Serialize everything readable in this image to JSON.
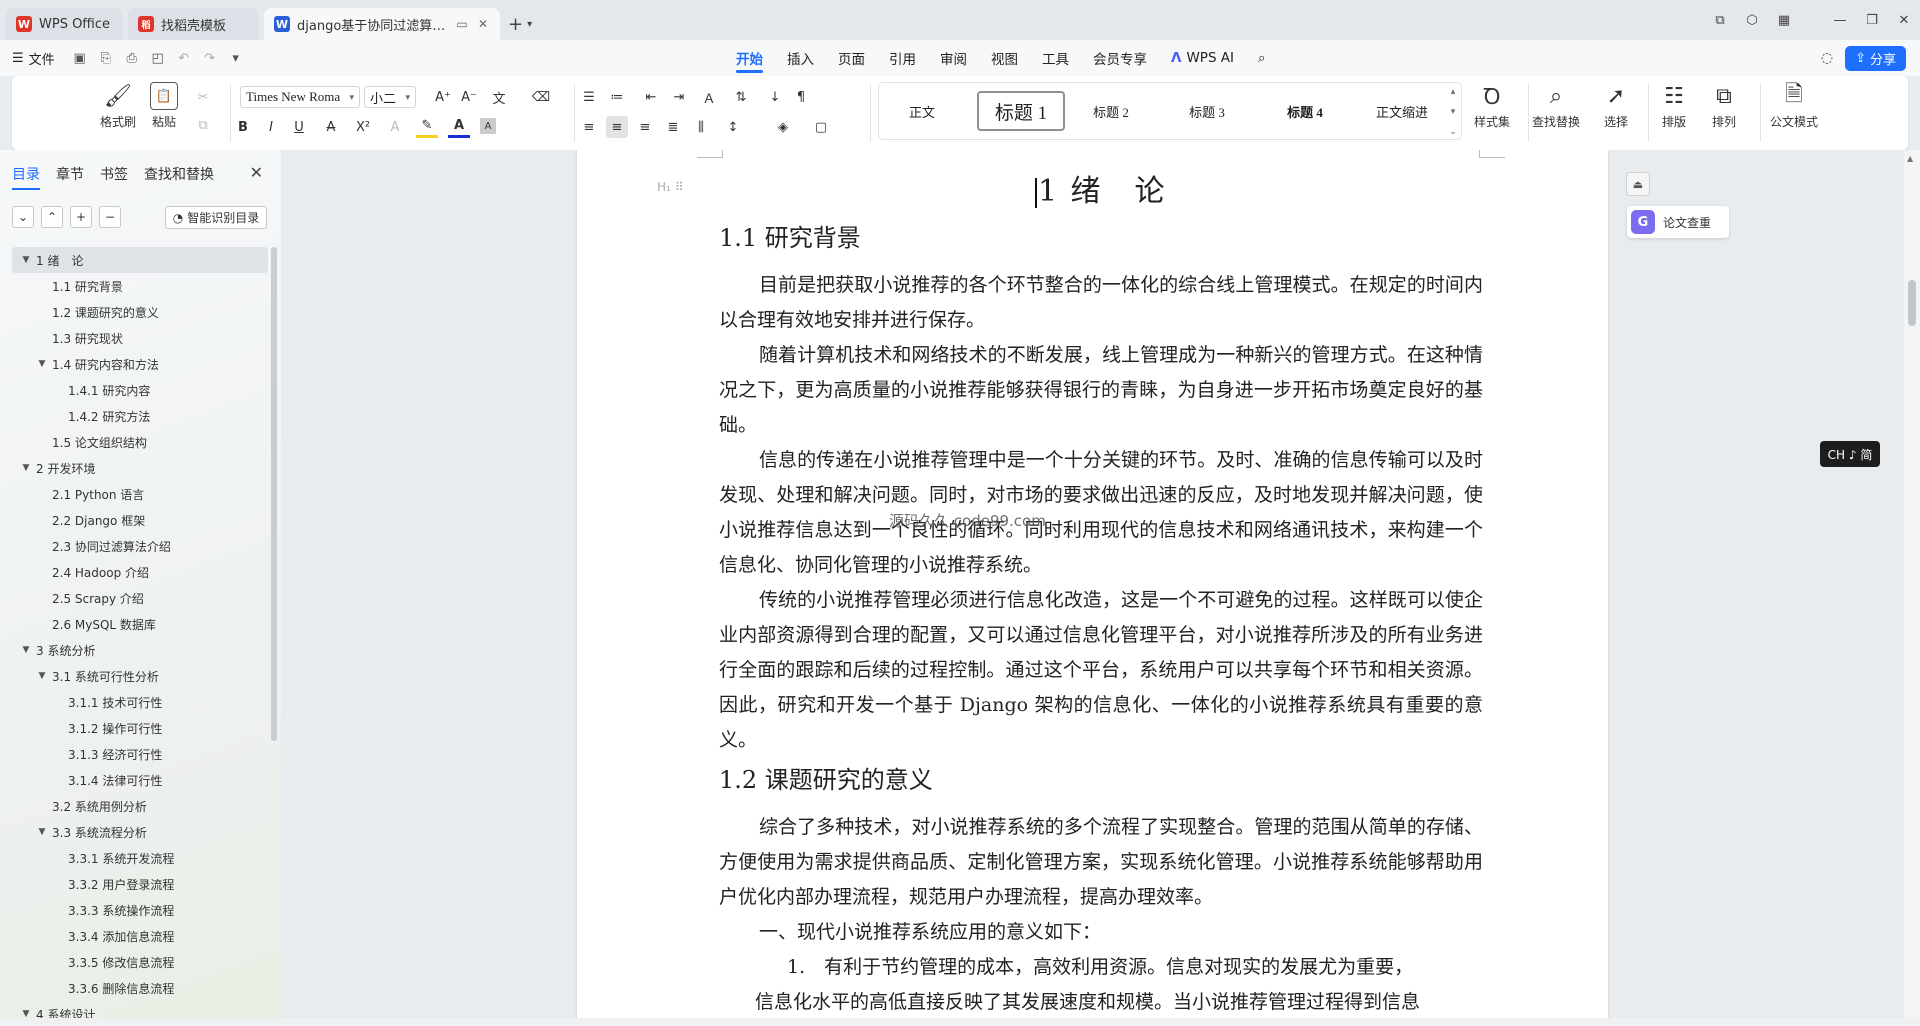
{
  "tabs": [
    {
      "label": "WPS Office",
      "logo": "W",
      "logo_color": "#e0352b",
      "active": false
    },
    {
      "label": "找稻壳模板",
      "logo": "稻",
      "logo_color": "#e0352b",
      "active": false
    },
    {
      "label": "django基于协同过滤算法的小",
      "logo": "W",
      "logo_color": "#2b5fd9",
      "active": true
    }
  ],
  "menubar": {
    "file_label": "文件",
    "tabs": [
      "开始",
      "插入",
      "页面",
      "引用",
      "审阅",
      "视图",
      "工具",
      "会员专享"
    ],
    "active_tab": "开始",
    "ai_label": "WPS AI",
    "share_label": "分享"
  },
  "ribbon": {
    "format_painter": "格式刷",
    "paste": "粘贴",
    "font_name": "Times New Roma",
    "font_size": "小二",
    "styles": [
      "正文",
      "标题 1",
      "标题 2",
      "标题 3",
      "标题 4",
      "正文缩进"
    ],
    "selected_style": "标题 1",
    "style_set": "样式集",
    "find_replace": "查找替换",
    "select": "选择",
    "layout": "排版",
    "arrange": "排列",
    "official_mode": "公文模式"
  },
  "left_panel": {
    "tabs": [
      "目录",
      "章节",
      "书签",
      "查找和替换"
    ],
    "active_tab": "目录",
    "smart_toc": "智能识别目录",
    "toc": [
      {
        "label": "1 绪　论",
        "level": 0,
        "expanded": true,
        "selected": true
      },
      {
        "label": "1.1 研究背景",
        "level": 1
      },
      {
        "label": "1.2 课题研究的意义",
        "level": 1
      },
      {
        "label": "1.3 研究现状",
        "level": 1
      },
      {
        "label": "1.4 研究内容和方法",
        "level": 1,
        "expanded": true
      },
      {
        "label": "1.4.1 研究内容",
        "level": 2
      },
      {
        "label": "1.4.2 研究方法",
        "level": 2
      },
      {
        "label": "1.5 论文组织结构",
        "level": 1
      },
      {
        "label": "2 开发环境",
        "level": 0,
        "expanded": true
      },
      {
        "label": "2.1 Python 语言",
        "level": 1
      },
      {
        "label": "2.2 Django 框架",
        "level": 1
      },
      {
        "label": "2.3 协同过滤算法介绍",
        "level": 1
      },
      {
        "label": "2.4 Hadoop 介绍",
        "level": 1
      },
      {
        "label": "2.5 Scrapy 介绍",
        "level": 1
      },
      {
        "label": "2.6 MySQL 数据库",
        "level": 1
      },
      {
        "label": "3 系统分析",
        "level": 0,
        "expanded": true
      },
      {
        "label": "3.1  系统可行性分析",
        "level": 1,
        "expanded": true
      },
      {
        "label": "3.1.1  技术可行性",
        "level": 2
      },
      {
        "label": "3.1.2  操作可行性",
        "level": 2
      },
      {
        "label": "3.1.3  经济可行性",
        "level": 2
      },
      {
        "label": "3.1.4  法律可行性",
        "level": 2
      },
      {
        "label": "3.2  系统用例分析",
        "level": 1
      },
      {
        "label": "3.3  系统流程分析",
        "level": 1,
        "expanded": true
      },
      {
        "label": "3.3.1  系统开发流程",
        "level": 2
      },
      {
        "label": "3.3.2  用户登录流程",
        "level": 2
      },
      {
        "label": "3.3.3  系统操作流程",
        "level": 2
      },
      {
        "label": "3.3.4  添加信息流程",
        "level": 2
      },
      {
        "label": "3.3.5  修改信息流程",
        "level": 2
      },
      {
        "label": "3.3.6  删除信息流程",
        "level": 2
      },
      {
        "label": "4  系统设计",
        "level": 0,
        "expanded": true
      }
    ]
  },
  "document": {
    "chapter_title": "1 绪　论",
    "watermark": "源码久久 code99.com",
    "sections": [
      {
        "heading": "1.1 研究背景",
        "paragraphs": [
          "目前是把获取小说推荐的各个环节整合的一体化的综合线上管理模式。在规定的时间内以合理有效地安排并进行保存。",
          "随着计算机技术和网络技术的不断发展，线上管理成为一种新兴的管理方式。在这种情况之下，更为高质量的小说推荐能够获得银行的青睐，为自身进一步开拓市场奠定良好的基础。",
          "信息的传递在小说推荐管理中是一个十分关键的环节。及时、准确的信息传输可以及时发现、处理和解决问题。同时，对市场的要求做出迅速的反应，及时地发现并解决问题，使小说推荐信息达到一个良性的循环。同时利用现代的信息技术和网络通讯技术，来构建一个信息化、协同化管理的小说推荐系统。",
          "传统的小说推荐管理必须进行信息化改造，这是一个不可避免的过程。这样既可以使企业内部资源得到合理的配置，又可以通过信息化管理平台，对小说推荐所涉及的所有业务进行全面的跟踪和后续的过程控制。通过这个平台，系统用户可以共享每个环节和相关资源。因此，研究和开发一个基于 Django 架构的信息化、一体化的小说推荐系统具有重要的意义。"
        ]
      },
      {
        "heading": "1.2 课题研究的意义",
        "paragraphs": [
          "综合了多种技术，对小说推荐系统的多个流程了实现整合。管理的范围从简单的存储、方便使用为需求提供商品质、定制化管理方案，实现系统化管理。小说推荐系统能够帮助用户优化内部办理流程，规范用户办理流程，提高办理效率。"
        ],
        "subline": "一、现代小说推荐系统应用的意义如下：",
        "numbered": "1.　有利于节约管理的成本，高效利用资源。信息对现实的发展尤为重要，",
        "continuation": "信息化水平的高低直接反映了其发展速度和规模。当小说推荐管理过程得到信息"
      }
    ]
  },
  "side": {
    "thesis_check": "论文查重",
    "ime_badge": "CH ♪ 简"
  }
}
